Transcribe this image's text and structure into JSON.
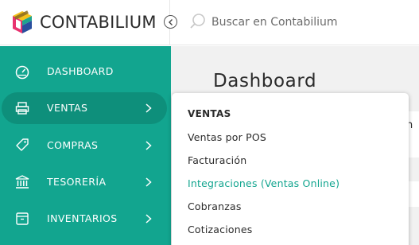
{
  "app": {
    "name": "CONTABILIUM",
    "brand_color": "#12a58f",
    "logo_badge": "CONTABIL"
  },
  "search": {
    "placeholder": "Buscar en Contabilium",
    "icon": "search-icon"
  },
  "sidebar": {
    "items": [
      {
        "label": "DASHBOARD",
        "icon": "dashboard-gauge-icon",
        "has_submenu": false,
        "active": false
      },
      {
        "label": "VENTAS",
        "icon": "printer-icon",
        "has_submenu": true,
        "active": true
      },
      {
        "label": "COMPRAS",
        "icon": "tag-icon",
        "has_submenu": true,
        "active": false
      },
      {
        "label": "TESORERÍA",
        "icon": "bank-icon",
        "has_submenu": true,
        "active": false
      },
      {
        "label": "INVENTARIOS",
        "icon": "box-icon",
        "has_submenu": true,
        "active": false
      }
    ]
  },
  "main": {
    "title": "Dashboard",
    "edge_text": "n"
  },
  "dropdown": {
    "header": "VENTAS",
    "items": [
      {
        "label": "Ventas por POS",
        "highlighted": false
      },
      {
        "label": "Facturación",
        "highlighted": false
      },
      {
        "label": "Integraciones (Ventas Online)",
        "highlighted": true
      },
      {
        "label": "Cobranzas",
        "highlighted": false
      },
      {
        "label": "Cotizaciones",
        "highlighted": false
      }
    ]
  }
}
